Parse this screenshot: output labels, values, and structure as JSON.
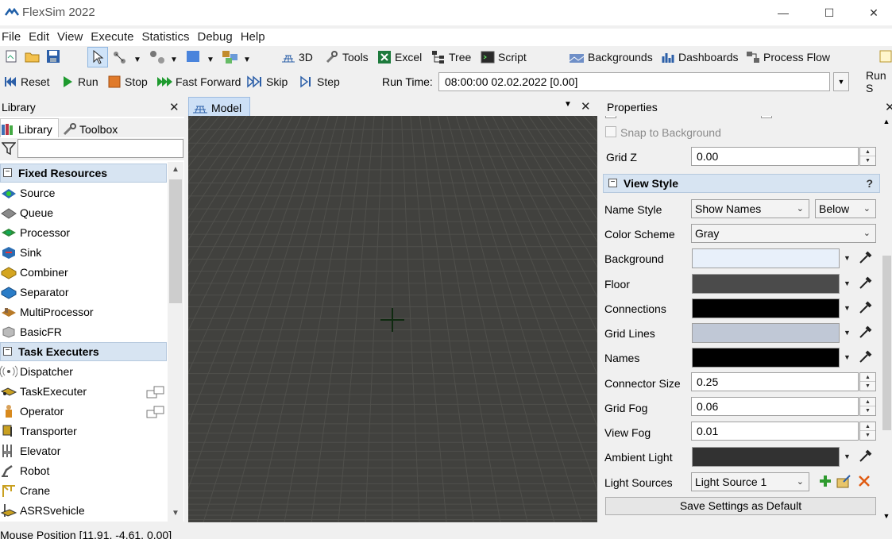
{
  "window": {
    "title": "FlexSim 2022",
    "minimize": "—",
    "maximize": "☐",
    "close": "✕"
  },
  "menu": [
    "File",
    "Edit",
    "View",
    "Execute",
    "Statistics",
    "Debug",
    "Help"
  ],
  "toolbar": {
    "three_d": "3D",
    "tools": "Tools",
    "excel": "Excel",
    "tree": "Tree",
    "script": "Script",
    "backgrounds": "Backgrounds",
    "dashboards": "Dashboards",
    "process_flow": "Process Flow"
  },
  "run_controls": {
    "reset": "Reset",
    "run": "Run",
    "stop": "Stop",
    "fast_forward": "Fast Forward",
    "skip": "Skip",
    "step": "Step",
    "run_time_label": "Run Time:",
    "run_time_value": "08:00:00  02.02.2022  [0.00]",
    "run_speed_label": "Run S"
  },
  "library": {
    "title": "Library",
    "tabs": [
      "Library",
      "Toolbox"
    ],
    "filter_value": "",
    "groups": [
      {
        "name": "Fixed Resources",
        "items": [
          "Source",
          "Queue",
          "Processor",
          "Sink",
          "Combiner",
          "Separator",
          "MultiProcessor",
          "BasicFR"
        ]
      },
      {
        "name": "Task Executers",
        "items": [
          "Dispatcher",
          "TaskExecuter",
          "Operator",
          "Transporter",
          "Elevator",
          "Robot",
          "Crane",
          "ASRSvehicle"
        ]
      }
    ]
  },
  "model": {
    "tab": "Model"
  },
  "properties": {
    "title": "Properties",
    "snap_to_background": "Snap to Background",
    "grid_z_label": "Grid Z",
    "grid_z": "0.00",
    "view_style_section": "View Style",
    "help": "?",
    "name_style_label": "Name Style",
    "name_style": "Show Names",
    "name_position": "Below",
    "color_scheme_label": "Color Scheme",
    "color_scheme": "Gray",
    "background_label": "Background",
    "floor_label": "Floor",
    "connections_label": "Connections",
    "grid_lines_label": "Grid Lines",
    "names_label": "Names",
    "connector_size_label": "Connector Size",
    "connector_size": "0.25",
    "grid_fog_label": "Grid Fog",
    "grid_fog": "0.06",
    "view_fog_label": "View Fog",
    "view_fog": "0.01",
    "ambient_light_label": "Ambient Light",
    "light_sources_label": "Light Sources",
    "light_source": "Light Source 1",
    "save_default": "Save Settings as Default",
    "colors": {
      "background": "#e8f0fa",
      "floor": "#4b4b4b",
      "connections": "#000000",
      "grid_lines": "#c0c8d6",
      "names": "#000000",
      "ambient_light": "#323232"
    }
  },
  "status": {
    "mouse_position": "Mouse Position [11.91, -4.61, 0.00]"
  }
}
